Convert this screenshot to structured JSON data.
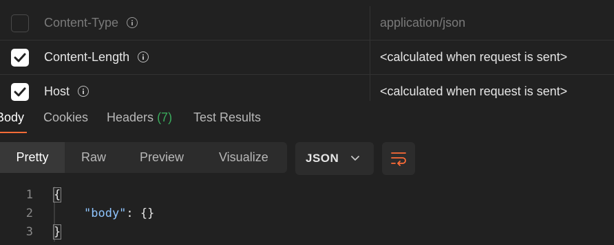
{
  "headers_table": {
    "rows": [
      {
        "key": "Content-Type",
        "value": "application/json",
        "checked": false,
        "muted": true
      },
      {
        "key": "Content-Length",
        "value": "<calculated when request is sent>",
        "checked": true,
        "muted": false
      },
      {
        "key": "Host",
        "value": "<calculated when request is sent>",
        "checked": true,
        "muted": false
      }
    ]
  },
  "response_tabs": {
    "body": "Body",
    "cookies": "Cookies",
    "headers": "Headers",
    "headers_count": "(7)",
    "test_results": "Test Results",
    "active": "Body"
  },
  "view_modes": {
    "pretty": "Pretty",
    "raw": "Raw",
    "preview": "Preview",
    "visualize": "Visualize",
    "active": "Pretty"
  },
  "format_select": {
    "value": "JSON"
  },
  "code": {
    "line_numbers": [
      "1",
      "2",
      "3"
    ],
    "open_brace": "{",
    "key": "\"body\"",
    "colon": ": ",
    "value": "{}",
    "close_brace": "}"
  },
  "colors": {
    "background": "#212121",
    "accent": "#ff6c37",
    "count_green": "#3aaa5c",
    "json_key": "#8fc5ff"
  },
  "icons": [
    "checkbox-unchecked",
    "checkbox-checked",
    "info-icon",
    "chevron-down-icon",
    "wrap-lines-icon"
  ]
}
